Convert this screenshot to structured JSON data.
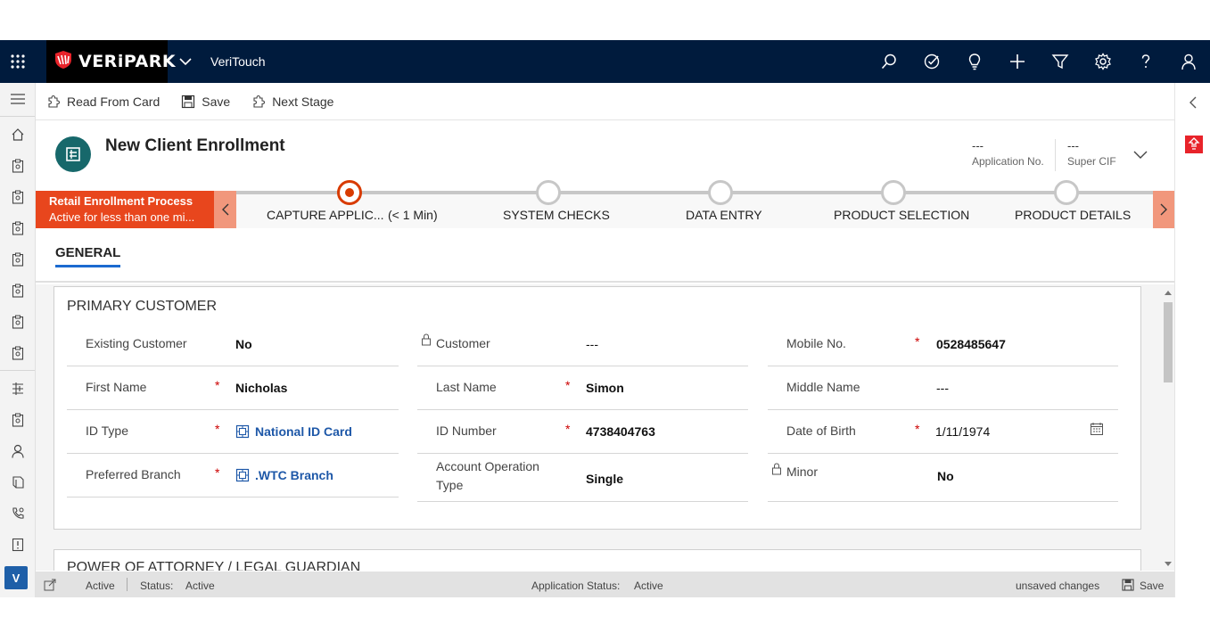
{
  "topbar": {
    "brand": "VERiPARK",
    "app_name": "VeriTouch",
    "icons": [
      "waffle-icon",
      "search-icon",
      "task-icon",
      "lightbulb-icon",
      "plus-icon",
      "filter-icon",
      "gear-icon",
      "help-icon",
      "user-icon"
    ],
    "background": "#001b3d"
  },
  "commands": {
    "read_from_card": "Read From Card",
    "save": "Save",
    "next_stage": "Next Stage"
  },
  "header": {
    "title": "New Client Enrollment",
    "application_no_value": "---",
    "application_no_label": "Application No.",
    "super_cif_value": "---",
    "super_cif_label": "Super CIF"
  },
  "process": {
    "name": "Retail Enrollment Process",
    "status": "Active for less than one mi...",
    "accent": "#e8461d",
    "stages": [
      {
        "label": "CAPTURE APPLIC...",
        "duration": "(< 1 Min)",
        "active": true
      },
      {
        "label": "SYSTEM CHECKS",
        "active": false
      },
      {
        "label": "DATA ENTRY",
        "active": false
      },
      {
        "label": "PRODUCT SELECTION",
        "active": false
      },
      {
        "label": "PRODUCT DETAILS",
        "active": false
      }
    ]
  },
  "tabs": {
    "general": "GENERAL"
  },
  "primary_customer": {
    "title": "PRIMARY CUSTOMER",
    "existing_customer": {
      "label": "Existing Customer",
      "value": "No"
    },
    "customer": {
      "label": "Customer",
      "value": "---"
    },
    "mobile_no": {
      "label": "Mobile No.",
      "value": "0528485647"
    },
    "first_name": {
      "label": "First Name",
      "value": "Nicholas"
    },
    "last_name": {
      "label": "Last Name",
      "value": "Simon"
    },
    "middle_name": {
      "label": "Middle Name",
      "value": "---"
    },
    "id_type": {
      "label": "ID Type",
      "value": "National ID Card"
    },
    "id_number": {
      "label": "ID Number",
      "value": "4738404763"
    },
    "date_of_birth": {
      "label": "Date of Birth",
      "value": "1/11/1974"
    },
    "preferred_branch": {
      "label": "Preferred Branch",
      "value": ".WTC Branch"
    },
    "account_operation_type": {
      "label_line1": "Account Operation",
      "label_line2": "Type",
      "value": "Single"
    },
    "minor": {
      "label": "Minor",
      "value": "No"
    },
    "required_mark": "*"
  },
  "poa_section": {
    "title": "POWER OF ATTORNEY / LEGAL GUARDIAN"
  },
  "footer": {
    "state": "Active",
    "status_label": "Status:",
    "status_value": "Active",
    "app_status_label": "Application Status:",
    "app_status_value": "Active",
    "unsaved": "unsaved changes",
    "save": "Save"
  },
  "leftnav": {
    "badge": "V",
    "icons": [
      "menu-icon",
      "home-icon",
      "record-icon",
      "record-icon",
      "record-icon",
      "record-icon",
      "record-icon",
      "record-icon",
      "record-icon",
      "hierarchy-icon",
      "record-icon",
      "person-icon",
      "book-icon",
      "phone-icon",
      "report-icon"
    ]
  }
}
